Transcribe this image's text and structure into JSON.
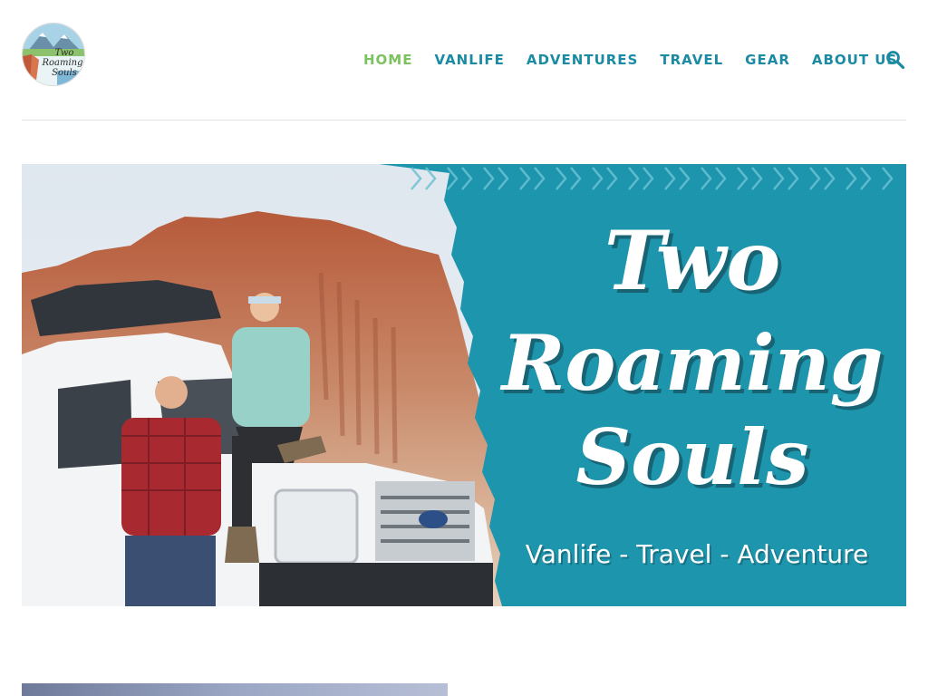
{
  "site": {
    "name": "Two Roaming Souls",
    "logo_text": [
      "Two",
      "Roaming",
      "Souls"
    ]
  },
  "nav": {
    "items": [
      {
        "label": "HOME",
        "active": true
      },
      {
        "label": "VANLIFE",
        "active": false
      },
      {
        "label": "ADVENTURES",
        "active": false
      },
      {
        "label": "TRAVEL",
        "active": false
      },
      {
        "label": "GEAR",
        "active": false
      },
      {
        "label": "ABOUT US",
        "active": false
      }
    ],
    "search_icon": "search-icon"
  },
  "hero": {
    "title_lines": [
      "Two",
      "Roaming",
      "Souls"
    ],
    "tagline": "Vanlife - Travel - Adventure"
  },
  "colors": {
    "nav_link": "#1b8aa3",
    "nav_active": "#7cc25f",
    "hero_panel": "#1d95ad"
  }
}
